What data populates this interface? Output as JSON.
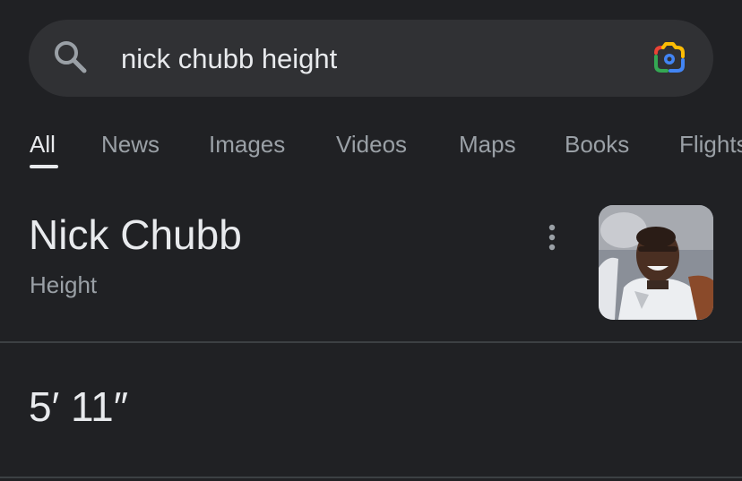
{
  "search": {
    "query": "nick chubb height",
    "icon": "search-icon",
    "lens_icon": "google-lens-icon"
  },
  "tabs": [
    {
      "label": "All",
      "active": true
    },
    {
      "label": "News",
      "active": false
    },
    {
      "label": "Images",
      "active": false
    },
    {
      "label": "Videos",
      "active": false
    },
    {
      "label": "Maps",
      "active": false
    },
    {
      "label": "Books",
      "active": false
    },
    {
      "label": "Flights",
      "active": false
    }
  ],
  "knowledge_panel": {
    "title": "Nick Chubb",
    "subtitle": "Height",
    "answer": "5′ 11″",
    "more_icon": "more-vert-icon"
  },
  "colors": {
    "background": "#202124",
    "search_bar": "#303134",
    "primary_text": "#e8eaed",
    "secondary_text": "#9aa0a6",
    "divider": "#3c4043"
  }
}
